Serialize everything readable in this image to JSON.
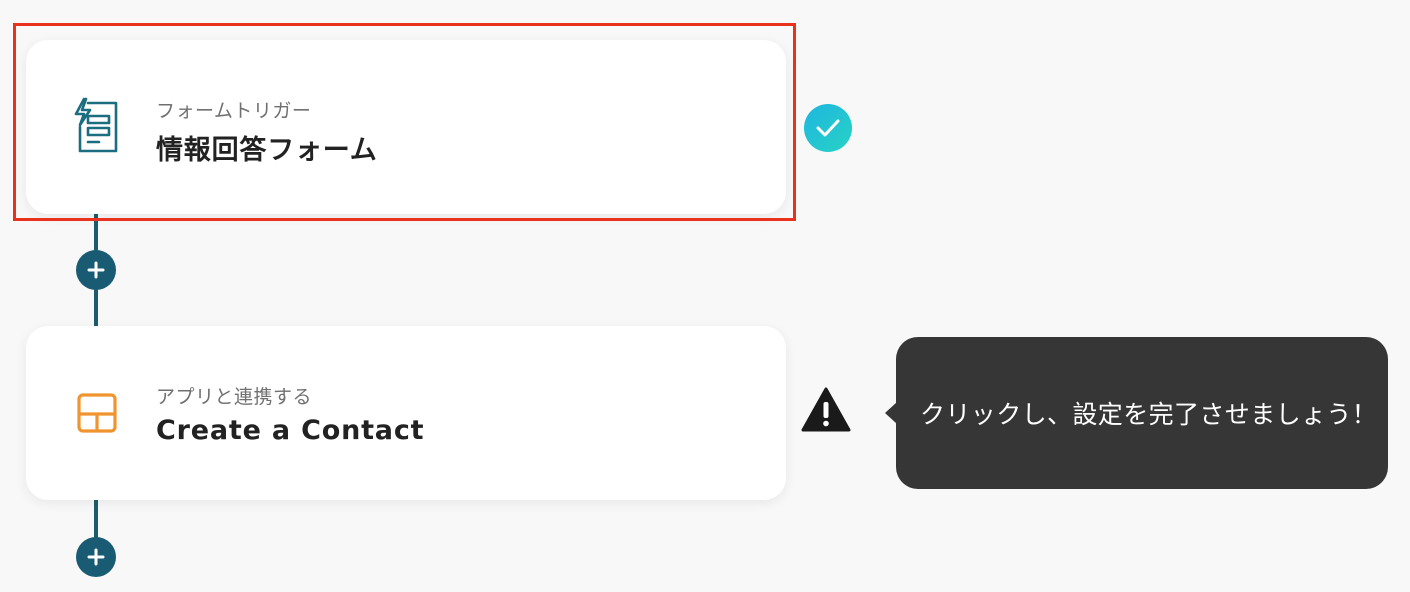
{
  "flow": {
    "steps": [
      {
        "type_label": "フォームトリガー",
        "title": "情報回答フォーム",
        "icon": "form-trigger-icon",
        "status": "complete",
        "icon_color": "#1b6d80"
      },
      {
        "type_label": "アプリと連携する",
        "title": "Create a Contact",
        "icon": "app-layout-icon",
        "status": "warning",
        "icon_color": "#f0942f"
      }
    ],
    "tooltip": "クリックし、設定を完了させましょう！",
    "accent_color": "#185b73",
    "highlight_color": "#e8321d"
  }
}
